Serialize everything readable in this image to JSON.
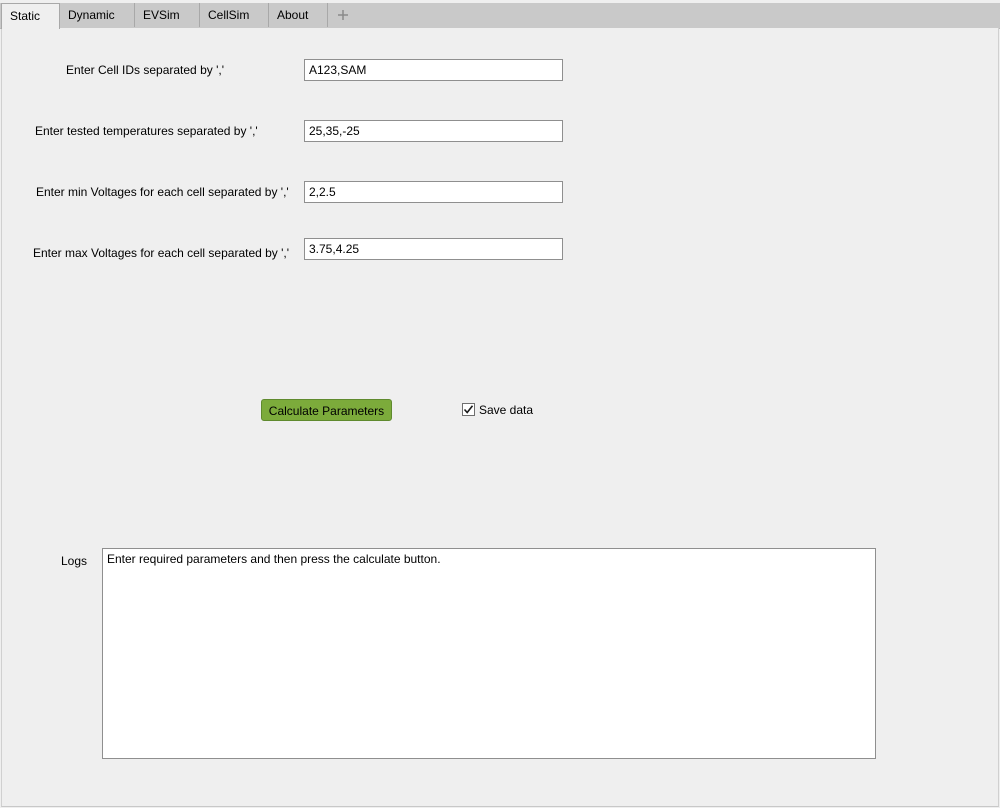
{
  "tabs": [
    {
      "label": "Static",
      "active": true
    },
    {
      "label": "Dynamic",
      "active": false
    },
    {
      "label": "EVSim",
      "active": false
    },
    {
      "label": "CellSim",
      "active": false
    },
    {
      "label": "About",
      "active": false
    }
  ],
  "add_tab_icon": "plus-icon",
  "form": {
    "cell_ids": {
      "label": "Enter Cell IDs separated by ','",
      "value": "A123,SAM"
    },
    "temperatures": {
      "label": "Enter tested temperatures separated by ','",
      "value": "25,35,-25"
    },
    "min_voltages": {
      "label": "Enter min Voltages for each cell separated by ','",
      "value": "2,2.5"
    },
    "max_voltages": {
      "label": "Enter max Voltages for each cell separated by ','",
      "value": "3.75,4.25"
    }
  },
  "actions": {
    "calculate_label": "Calculate Parameters",
    "save_data_label": "Save data",
    "save_data_checked": true
  },
  "logs": {
    "label": "Logs",
    "text": "Enter required parameters and then press the calculate button."
  },
  "colors": {
    "button_green": "#7cab3b"
  }
}
